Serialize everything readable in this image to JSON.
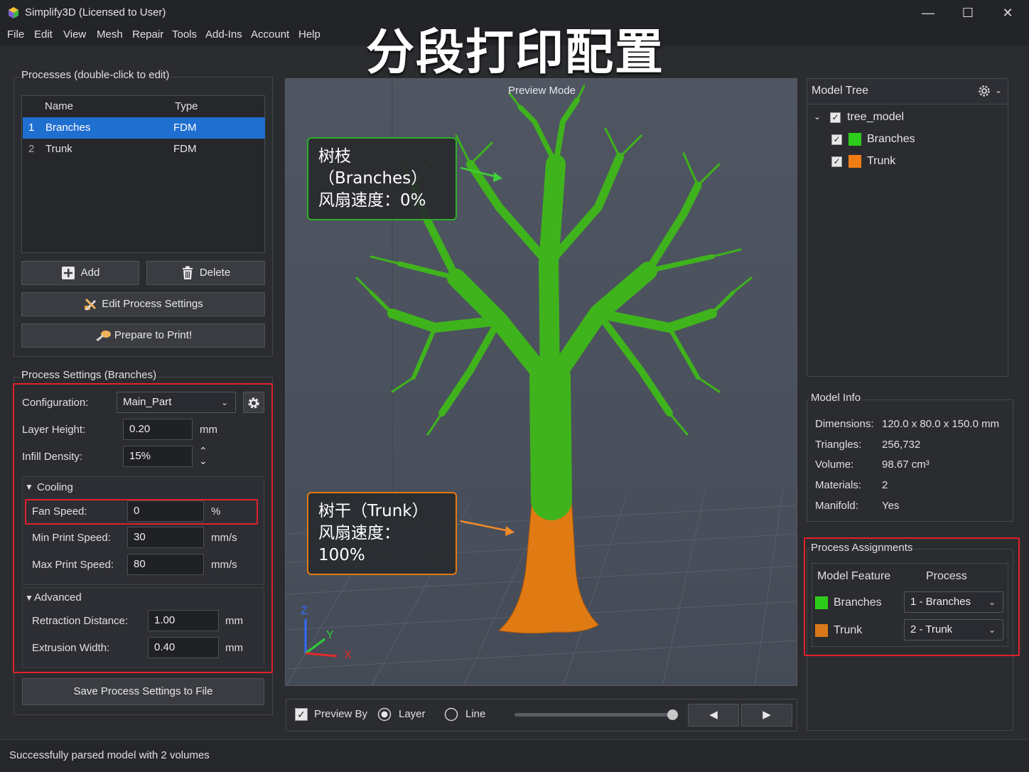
{
  "window": {
    "title": "Simplify3D (Licensed to User)",
    "minimize": "—",
    "maximize": "☐",
    "close": "✕"
  },
  "menu": [
    "File",
    "Edit",
    "View",
    "Mesh",
    "Repair",
    "Tools",
    "Add-Ins",
    "Account",
    "Help"
  ],
  "banner": "分段打印配置",
  "processes": {
    "title": "Processes (double-click to edit)",
    "columns": [
      "Name",
      "Type"
    ],
    "rows": [
      {
        "index": "1",
        "name": "Branches",
        "type": "FDM",
        "selected": true
      },
      {
        "index": "2",
        "name": "Trunk",
        "type": "FDM",
        "selected": false
      }
    ],
    "add_label": "Add",
    "delete_label": "Delete",
    "edit_label": "Edit Process Settings",
    "prepare_label": "Prepare to Print!"
  },
  "settings": {
    "title": "Process Settings (Branches)",
    "configuration_label": "Configuration:",
    "configuration_value": "Main_Part",
    "layer_height_label": "Layer Height:",
    "layer_height_value": "0.20",
    "layer_height_unit": "mm",
    "infill_label": "Infill Density:",
    "infill_value": "15%",
    "cooling_title": "Cooling",
    "fan_speed_label": "Fan Speed:",
    "fan_speed_value": "0",
    "fan_speed_unit": "%",
    "min_speed_label": "Min Print Speed:",
    "min_speed_value": "30",
    "min_speed_unit": "mm/s",
    "max_speed_label": "Max Print Speed:",
    "max_speed_value": "80",
    "max_speed_unit": "mm/s",
    "advanced_title": "Advanced",
    "retraction_label": "Retraction Distance:",
    "retraction_value": "1.00",
    "retraction_unit": "mm",
    "extrusion_label": "Extrusion Width:",
    "extrusion_value": "0.40",
    "extrusion_unit": "mm",
    "save_label": "Save Process Settings to File"
  },
  "viewport": {
    "mode": "Preview Mode",
    "callout_branches_line1": "树枝（Branches）",
    "callout_branches_line2": "风扇速度：0%",
    "callout_trunk_line1": "树干（Trunk）",
    "callout_trunk_line2": "风扇速度：100%",
    "axis_z": "Z",
    "axis_y": "Y",
    "axis_x": "X",
    "branch_color": "#3fb31c",
    "trunk_color": "#e07a12"
  },
  "preview_bar": {
    "preview_by_label": "Preview By",
    "preview_by_checked": true,
    "layer_label": "Layer",
    "line_label": "Line",
    "selected_mode": "Layer",
    "slider_position": 1.0
  },
  "model_tree": {
    "title": "Model Tree",
    "root": "tree_model",
    "items": [
      {
        "label": "Branches",
        "color": "#2ecc1a"
      },
      {
        "label": "Trunk",
        "color": "#f07d14"
      }
    ]
  },
  "model_info": {
    "title": "Model Info",
    "rows": [
      {
        "label": "Dimensions:",
        "value": "120.0 x 80.0 x 150.0 mm"
      },
      {
        "label": "Triangles:",
        "value": "256,732"
      },
      {
        "label": "Volume:",
        "value": "98.67 cm³"
      },
      {
        "label": "Materials:",
        "value": "2"
      },
      {
        "label": "Manifold:",
        "value": "Yes"
      }
    ]
  },
  "assignments": {
    "title": "Process Assignments",
    "columns": [
      "Model Feature",
      "Process"
    ],
    "rows": [
      {
        "feature": "Branches",
        "process": "1 - Branches",
        "color": "#2ecc1a"
      },
      {
        "feature": "Trunk",
        "process": "2 - Trunk",
        "color": "#d9781a"
      }
    ]
  },
  "status": "Successfully parsed model with 2 volumes",
  "highlight_color": "#e0222a"
}
